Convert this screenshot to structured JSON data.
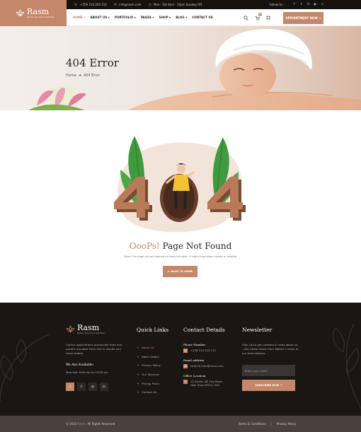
{
  "brand": {
    "name": "Rasm",
    "tagline": "Beauty, Spa Care & Nail Salon",
    "accent": "#c4876a",
    "dark": "#15110f"
  },
  "topbar": {
    "phone": "+256 214 203 215",
    "email": "info@rasm.com",
    "hours": "Mon - Sat 8am - 10pm Sunday Off",
    "follow_label": "Follow Us :",
    "socials": [
      "facebook-icon",
      "twitter-icon",
      "linkedin-icon",
      "youtube-icon",
      "skype-icon"
    ]
  },
  "nav": {
    "items": [
      "HOME",
      "ABOUT US",
      "PORTFOLIO",
      "PAGES",
      "SHOP",
      "BLOG",
      "CONTACT US"
    ],
    "cart_count": "0",
    "appointment_label": "APPOINTMENT NOW ➜"
  },
  "banner": {
    "title": "404 Error",
    "breadcrumb_home": "Home",
    "breadcrumb_current": "404 Error"
  },
  "error": {
    "heading_accent": "OooPs!",
    "heading_rest": "Page Not Found",
    "message": "Oops! The page you are looking for does not exist. It might have been moved or deleted.",
    "back_label": "BACK TO HOME",
    "illustration_text": "404"
  },
  "footer": {
    "about": "Centric applications productize front end portals visualize front end is results and value added",
    "available_heading": "We Are Available:",
    "available_hours": "Mon-Sat: 8:00 am to 15:00 pm",
    "socials": [
      "facebook-icon",
      "twitter-icon",
      "instagram-icon",
      "linkedin-icon"
    ],
    "quick_links_heading": "Quick Links",
    "quick_links": [
      "About Us",
      "Work Gallery",
      "Privacy Policy",
      "Our Services",
      "Pricing Plans",
      "Contact Us"
    ],
    "contact_heading": "Contact Details",
    "phone_label": "Phone Number",
    "phone": "+256 214 203 215",
    "email_label": "Email address",
    "email": "help24/7info@rasm.com",
    "office_label": "Office Location",
    "office_line1": "25 Street, NE City Road",
    "office_line2": "New Town DD14, USA",
    "newsletter_heading": "Newsletter",
    "newsletter_text": "Sign Up to get updates & news about us . Get Latest Deals from Walker's Inbox to our mail address.",
    "email_placeholder": "Enter your email",
    "subscribe_label": "SUBSCRIBE NOW ➜"
  },
  "copyright": {
    "prefix": "© 2023",
    "brand": "Rasm",
    "suffix": ". All Rights Reserved.",
    "terms": "Terms & Conditions",
    "separator": "|",
    "privacy": "Privacy Policy"
  }
}
